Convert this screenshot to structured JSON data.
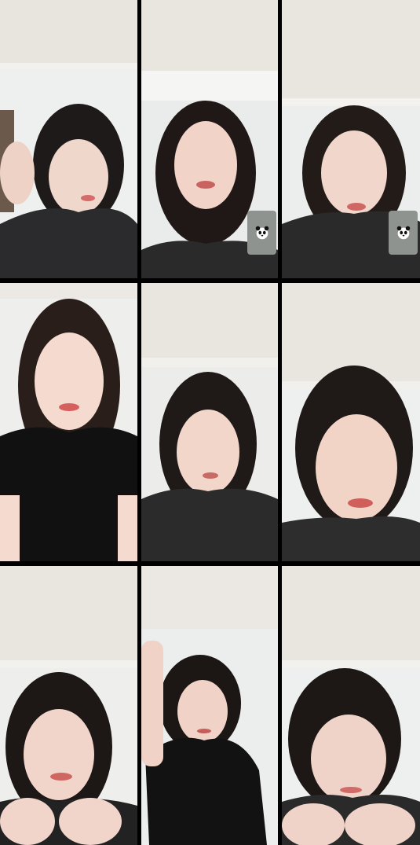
{
  "tiles": [
    {
      "id": 1,
      "shirt": "#2b2b2d",
      "skin": "#efd7cc",
      "hair": "#1f1a1a",
      "badge": false
    },
    {
      "id": 2,
      "shirt": "#2a2a2b",
      "skin": "#f1d3c7",
      "hair": "#201816",
      "badge": true
    },
    {
      "id": 3,
      "shirt": "#2a2a2b",
      "skin": "#f0d6cb",
      "hair": "#231b18",
      "badge": true
    },
    {
      "id": 4,
      "shirt": "#111111",
      "skin": "#f4dacf",
      "hair": "#2a1e1a",
      "badge": false
    },
    {
      "id": 5,
      "shirt": "#2b2b2b",
      "skin": "#f2d6ca",
      "hair": "#1f1917",
      "badge": false
    },
    {
      "id": 6,
      "shirt": "#2d2d2e",
      "skin": "#f1d4c6",
      "hair": "#1f1917",
      "badge": false
    },
    {
      "id": 7,
      "shirt": "#222222",
      "skin": "#f1d5ca",
      "hair": "#1d1716",
      "badge": false
    },
    {
      "id": 8,
      "shirt": "#121212",
      "skin": "#f0d3c6",
      "hair": "#1c1614",
      "badge": false
    },
    {
      "id": 9,
      "shirt": "#2a2a2a",
      "skin": "#efd3c8",
      "hair": "#1d1716",
      "badge": false
    }
  ],
  "badge_icon": "panda-icon"
}
